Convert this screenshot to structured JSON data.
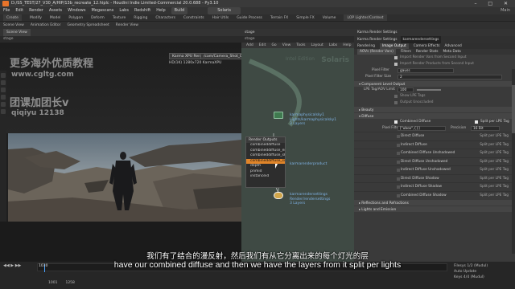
{
  "window": {
    "title": "D:/SS_TEST/27_V30_A/HIP/13b_recreate_12.hiplc - Houdini Indie Limited-Commercial 20.0.688 - Py3.10",
    "controls": "– □ ✕"
  },
  "menubar": {
    "items": [
      "File",
      "Edit",
      "Render",
      "Assets",
      "Windows",
      "Megascans",
      "Labs",
      "Redshift",
      "Help"
    ],
    "build": "Build",
    "context": "Solaris",
    "right": "Main"
  },
  "toolbar1": {
    "tabs": [
      "Create",
      "Modify",
      "Model",
      "Polygon",
      "Deform",
      "Texture",
      "Rigging",
      "Characters",
      "Constraints",
      "Hair Utils",
      "Guide Process",
      "Terrain FX",
      "Simple FX",
      "Volume"
    ],
    "extra": "LOP Lighter/Context"
  },
  "toolbar2": {
    "tabs": [
      "Scene View",
      "Animation Editor",
      "Geometry Spreadsheet",
      "Render View"
    ]
  },
  "viewport": {
    "tab": "Scene View",
    "path": "stage",
    "camera_select": "Karma XPU Render",
    "camera_name": "/cam/Camera_Shot_01",
    "perf": "HD(1K) 1280x720 KarmaXPU"
  },
  "watermark": {
    "line1": "更多海外优质教程",
    "line2": "www.cgltg.com",
    "line3": "团课加团长v",
    "line4": "qiqiyu 12138"
  },
  "network": {
    "tab": "stage",
    "path": "stage",
    "menu": [
      "Add",
      "Edit",
      "Go",
      "View",
      "Tools",
      "Layout",
      "Labs",
      "Help"
    ],
    "context_label": "Solaris",
    "watermark_title": "Intel Edition",
    "nodes": [
      {
        "name": "karmaphysicalsky1",
        "sub": "Lights/karmaphysicalsky1",
        "extra": "3 Layers"
      },
      {
        "name": "karmarendersettings",
        "sub": "Render/rendersettings",
        "extra": "3 Layers"
      },
      {
        "name": "karmarenderproduct",
        "sub": "",
        "extra": ""
      }
    ],
    "popup_title": "Render Outputs",
    "popup_items": [
      "combineddiffuse",
      "combineddiffuse_emission",
      "combineddiffuse_sky",
      "combineddiffuse_sun",
      "depth",
      "primid",
      "instanceid"
    ],
    "popup_selected": 3
  },
  "params": {
    "header": "Karma Render Settings",
    "node_name": "karmarendersettings",
    "tabs": [
      "Rendering",
      "Image Output",
      "Camera Effects",
      "Advanced"
    ],
    "active_tab": 1,
    "subtabs": [
      "AOVs (Render Vars)",
      "Filters",
      "Render Stats",
      "Meta Data"
    ],
    "rows": [
      {
        "label": "",
        "value": "Import Render Vars from Second Input"
      },
      {
        "label": "",
        "value": "Import Render Products from Second Input"
      },
      {
        "label": "Pixel Filter",
        "value": "gauss"
      },
      {
        "label": "Pixel Filter Size",
        "value": "2"
      }
    ],
    "sections": {
      "component": "Component Level Output",
      "beauty": "Beauty",
      "diffuse": "Diffuse",
      "reflections": "Reflections and Refractions",
      "lights": "Lights and Emission"
    },
    "lpe_tag_label": "LPE Tag/AOV Limit",
    "lpe_tag_value": "100",
    "show_lpe": "Show LPE Tags",
    "output_unlit": "Output Unoccluded",
    "combined_diffuse": "Combined Diffuse",
    "split_per_lpe": "Split per LPE Tag",
    "pixel_filter_label": "Pixel Filter",
    "pixel_filter_value": "[\"ubox\",{}]",
    "precision_label": "Precision",
    "precision_value": "16 Bit",
    "lpe_rows": [
      "Direct Diffuse",
      "Indirect Diffuse",
      "Combined Diffuse Unshadowed",
      "Direct Diffuse Unshadowed",
      "Indirect Diffuse Unshadowed",
      "Direct Diffuse Shadow",
      "Indirect Diffuse Shadow",
      "Combined Diffuse Shadow"
    ],
    "lpe_right": "Split per LPE Tag"
  },
  "timeline": {
    "frame_current": "1030",
    "frame_start": "1001",
    "frame_end": "1258",
    "range_a": "1001",
    "range_b": "1258",
    "right_top": "Filesys 1/2 (Mudul)",
    "right_mid": "Auto Update",
    "right_bot": "Keys 4/4 (Mudul)"
  },
  "subtitles": {
    "zh": "我们有了结合的漫反射，然后我们有从它分离出来的每个灯光的层",
    "en": "have our combined diffuse and then we have the layers from it split per lights"
  }
}
